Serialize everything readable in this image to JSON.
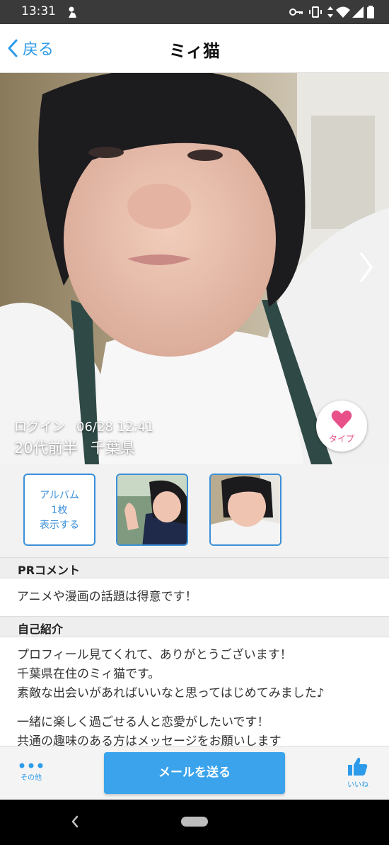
{
  "status_bar": {
    "time": "13:31"
  },
  "nav": {
    "back_label": "戻る",
    "title": "ミィ猫"
  },
  "hero": {
    "login_label": "ログイン",
    "login_time": "06/28 12:41",
    "age": "20代前半",
    "location": "千葉県",
    "type_label": "タイプ"
  },
  "album": {
    "line1": "アルバム",
    "line2": "1枚",
    "line3": "表示する"
  },
  "pr": {
    "heading": "PRコメント",
    "text": "アニメや漫画の話題は得意です！"
  },
  "intro": {
    "heading": "自己紹介",
    "lines": [
      "プロフィール見てくれて、ありがとうございます！",
      "千葉県在住のミィ猫です。",
      "素敵な出会いがあればいいなと思ってはじめてみました♪",
      "一緒に楽しく過ごせる人と恋愛がしたいです！",
      "共通の趣味のある方はメッセージをお願いします"
    ]
  },
  "bottom": {
    "other_label": "その他",
    "mail_label": "メールを送る",
    "like_label": "いいね"
  },
  "colors": {
    "accent": "#2d9bea",
    "button": "#3aa3ec",
    "type_pink": "#e8508a"
  }
}
